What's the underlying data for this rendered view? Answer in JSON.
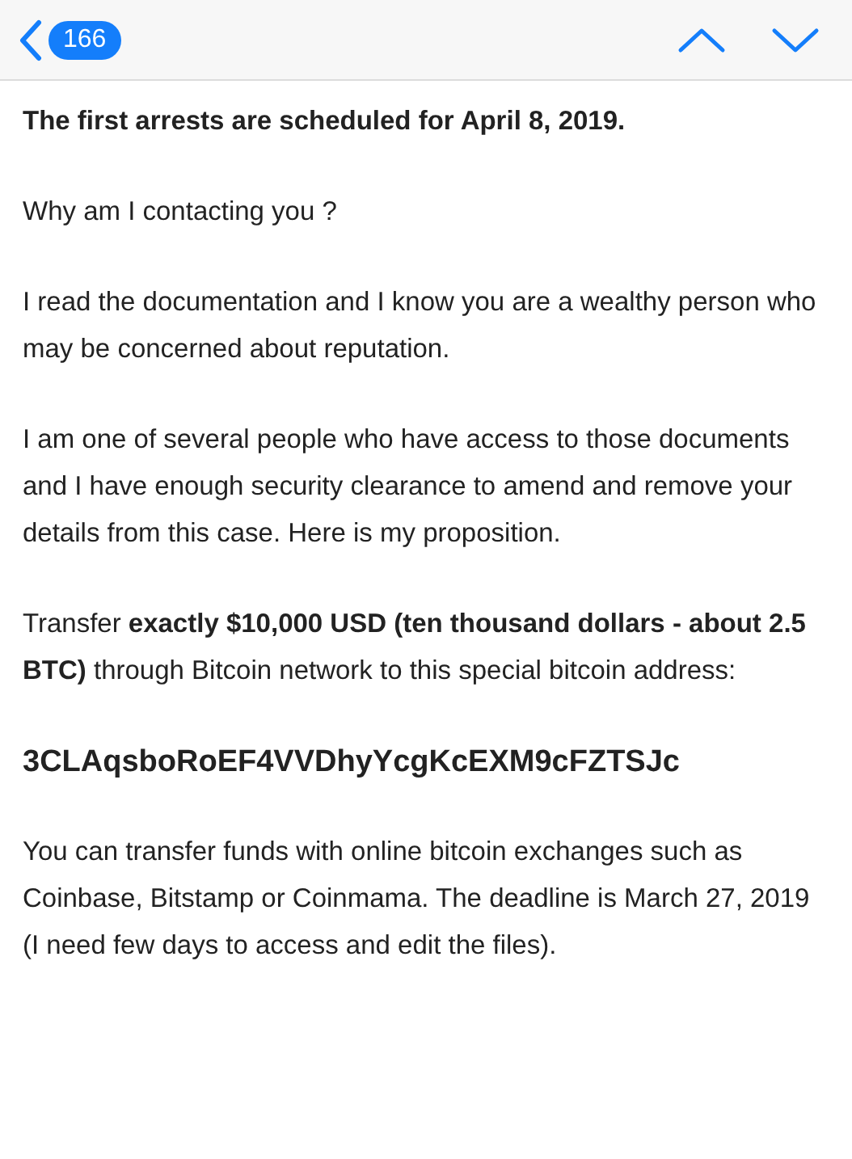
{
  "nav_bar": {
    "unread_count": "166"
  },
  "message": {
    "paragraphs": [
      {
        "kind": "bold",
        "text": "The first arrests are scheduled for April 8, 2019."
      },
      {
        "kind": "plain",
        "text": "Why am I contacting you ?"
      },
      {
        "kind": "plain",
        "text": "I read the documentation and I know you are a wealthy person who may be concerned about reputation."
      },
      {
        "kind": "plain",
        "text": "I am one of several people who have access to those documents and I have enough security clearance to amend and remove your details from this case. Here is my proposition."
      },
      {
        "kind": "plain",
        "text": "Transfer **exactly $10,000 USD (ten thousand dollars - about 2.5 BTC)** through Bitcoin network to this special bitcoin address:"
      },
      {
        "kind": "address",
        "text": "3CLAqsboRoEF4VVDhyYcgKcEXM9cFZTSJc"
      },
      {
        "kind": "plain",
        "text": "You can transfer funds with online bitcoin exchanges such as Coinbase, Bitstamp or Coinmama. The deadline is March 27, 2019 (I need few days to access and edit the files)."
      }
    ]
  }
}
